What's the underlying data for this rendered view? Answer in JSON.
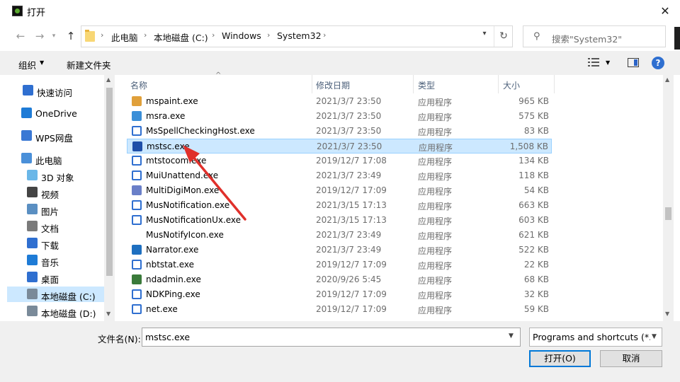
{
  "window": {
    "title": "打开",
    "close_symbol": "✕"
  },
  "address": {
    "breadcrumbs": [
      "此电脑",
      "本地磁盘 (C:)",
      "Windows",
      "System32"
    ],
    "separator": "›"
  },
  "search": {
    "placeholder": "搜索\"System32\""
  },
  "toolbar": {
    "organize_label": "组织",
    "new_folder_label": "新建文件夹",
    "help_symbol": "?"
  },
  "sidebar": {
    "items": [
      {
        "label": "快速访问",
        "icon": "star-icon",
        "color": "#2f6fd0"
      },
      {
        "label": "OneDrive",
        "icon": "cloud-icon",
        "color": "#1e7bd6"
      },
      {
        "label": "WPS网盘",
        "icon": "cloud-icon",
        "color": "#3a78d4"
      },
      {
        "label": "此电脑",
        "icon": "computer-icon",
        "color": "#4a90d9"
      },
      {
        "label": "3D 对象",
        "icon": "cube-icon",
        "color": "#6ab7e8"
      },
      {
        "label": "视频",
        "icon": "film-icon",
        "color": "#444444"
      },
      {
        "label": "图片",
        "icon": "picture-icon",
        "color": "#5a8fc2"
      },
      {
        "label": "文档",
        "icon": "document-icon",
        "color": "#7a7a7a"
      },
      {
        "label": "下载",
        "icon": "download-icon",
        "color": "#2f6fd0"
      },
      {
        "label": "音乐",
        "icon": "music-icon",
        "color": "#1e7bd6"
      },
      {
        "label": "桌面",
        "icon": "desktop-icon",
        "color": "#2f6fd0"
      },
      {
        "label": "本地磁盘 (C:)",
        "icon": "drive-icon",
        "color": "#7a8a99"
      },
      {
        "label": "本地磁盘 (D:)",
        "icon": "drive-icon",
        "color": "#7a8a99"
      }
    ],
    "selected_index": 11
  },
  "columns": {
    "name": "名称",
    "modified": "修改日期",
    "type": "类型",
    "size": "大小",
    "sort_indicator": "^"
  },
  "files": [
    {
      "name": "mspaint.exe",
      "date": "2021/3/7 23:50",
      "type": "应用程序",
      "size": "965 KB",
      "icon": "paint-palette-icon",
      "color": "#e0a03a"
    },
    {
      "name": "msra.exe",
      "date": "2021/3/7 23:50",
      "type": "应用程序",
      "size": "575 KB",
      "icon": "monitor-icon",
      "color": "#3b8fd8"
    },
    {
      "name": "MsSpellCheckingHost.exe",
      "date": "2021/3/7 23:50",
      "type": "应用程序",
      "size": "83 KB",
      "icon": "window-exe-icon",
      "color": "#2f6fd0"
    },
    {
      "name": "mstsc.exe",
      "date": "2021/3/7 23:50",
      "type": "应用程序",
      "size": "1,508 KB",
      "icon": "remote-desktop-icon",
      "color": "#1f4fa8"
    },
    {
      "name": "mtstocom.exe",
      "date": "2019/12/7 17:08",
      "type": "应用程序",
      "size": "134 KB",
      "icon": "window-exe-icon",
      "color": "#2f6fd0"
    },
    {
      "name": "MuiUnattend.exe",
      "date": "2021/3/7 23:49",
      "type": "应用程序",
      "size": "118 KB",
      "icon": "window-exe-icon",
      "color": "#2f6fd0"
    },
    {
      "name": "MultiDigiMon.exe",
      "date": "2019/12/7 17:09",
      "type": "应用程序",
      "size": "54 KB",
      "icon": "settings-gear-icon",
      "color": "#6a7fc8"
    },
    {
      "name": "MusNotification.exe",
      "date": "2021/3/15 17:13",
      "type": "应用程序",
      "size": "663 KB",
      "icon": "window-exe-icon",
      "color": "#2f6fd0"
    },
    {
      "name": "MusNotificationUx.exe",
      "date": "2021/3/15 17:13",
      "type": "应用程序",
      "size": "603 KB",
      "icon": "window-exe-icon",
      "color": "#2f6fd0"
    },
    {
      "name": "MusNotifyIcon.exe",
      "date": "2021/3/7 23:49",
      "type": "应用程序",
      "size": "621 KB",
      "icon": "blank-icon",
      "color": "#ffffff"
    },
    {
      "name": "Narrator.exe",
      "date": "2021/3/7 23:49",
      "type": "应用程序",
      "size": "522 KB",
      "icon": "narrator-icon",
      "color": "#1e6fc0"
    },
    {
      "name": "nbtstat.exe",
      "date": "2019/12/7 17:09",
      "type": "应用程序",
      "size": "22 KB",
      "icon": "window-exe-icon",
      "color": "#2f6fd0"
    },
    {
      "name": "ndadmin.exe",
      "date": "2020/9/26 5:45",
      "type": "应用程序",
      "size": "68 KB",
      "icon": "ndadmin-icon",
      "color": "#3a7a3a"
    },
    {
      "name": "NDKPing.exe",
      "date": "2019/12/7 17:09",
      "type": "应用程序",
      "size": "32 KB",
      "icon": "window-exe-icon",
      "color": "#2f6fd0"
    },
    {
      "name": "net.exe",
      "date": "2019/12/7 17:09",
      "type": "应用程序",
      "size": "59 KB",
      "icon": "window-exe-icon",
      "color": "#2f6fd0"
    }
  ],
  "selected_file_index": 3,
  "filename": {
    "label": "文件名(N):",
    "value": "mstsc.exe"
  },
  "filter": {
    "selected": "Programs and shortcuts (*.exe"
  },
  "buttons": {
    "open_label": "打开(O)",
    "cancel_label": "取消"
  },
  "colors": {
    "selection": "#cce8ff",
    "accent": "#0078d7",
    "annotation_arrow": "#e0302b"
  }
}
